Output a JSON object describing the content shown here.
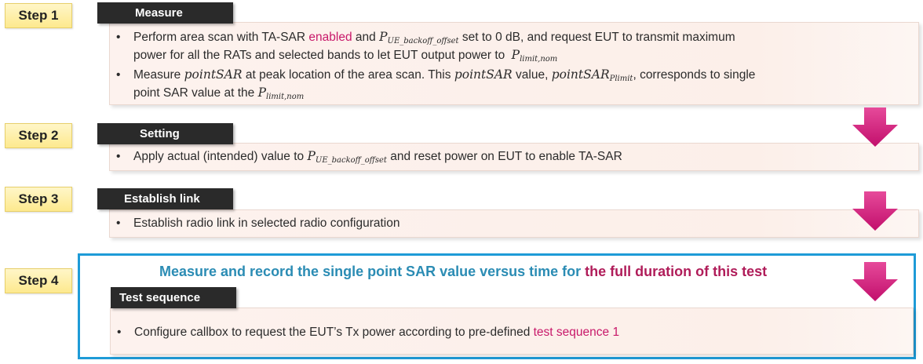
{
  "steps": [
    {
      "label": "Step 1",
      "header": "Measure",
      "bullets": {
        "b1_line1_a": "Perform area scan with TA-SAR",
        "b1_line1_enabled": "enabled",
        "b1_line1_and": "and",
        "b1_line1_P": "P",
        "b1_line1_sub": "UE_backoff_offset",
        "b1_line1_b": "set to 0 dB, and request EUT to transmit maximum",
        "b1_line2_a": "power for all the RATs and selected bands to let EUT output power to",
        "b1_line2_P": "P",
        "b1_line2_sub": "limit,nom",
        "b2_line1_a": "Measure",
        "b2_line1_math1": "pointSAR",
        "b2_line1_b": "at peak location of the area scan. This",
        "b2_line1_math2": "pointSAR",
        "b2_line1_c": "value,",
        "b2_line1_math3": "pointSAR",
        "b2_line1_sub3": "Plimit",
        "b2_line1_d": ", corresponds to single",
        "b2_line2_a": "point SAR value at the",
        "b2_line2_P": "P",
        "b2_line2_sub": "limit,nom"
      }
    },
    {
      "label": "Step 2",
      "header": "Setting",
      "bullets": {
        "a": "Apply actual (intended) value to",
        "P": "P",
        "sub": "UE_backoff_offset",
        "b": "and reset power on EUT to enable TA-SAR"
      }
    },
    {
      "label": "Step 3",
      "header": "Establish link",
      "bullets": {
        "a": "Establish radio link in selected radio configuration"
      }
    },
    {
      "label": "Step 4",
      "header": "Test sequence",
      "banner_a": "Measure and record the single point SAR value versus time for",
      "banner_b": "the full duration of this test",
      "bullets": {
        "a": "Configure callbox to request the EUT’s Tx power according to pre-defined",
        "b": "test sequence 1"
      }
    }
  ],
  "bullet_char": "•",
  "colors": {
    "arrow": "#d9177d",
    "outline": "#1e9bd7",
    "highlight_pink": "#c8196a",
    "banner_blue": "#2b8cb4",
    "banner_pink": "#b01d5a",
    "header_bg": "#2a2a2a",
    "step_label_bg": "#fde98e"
  }
}
